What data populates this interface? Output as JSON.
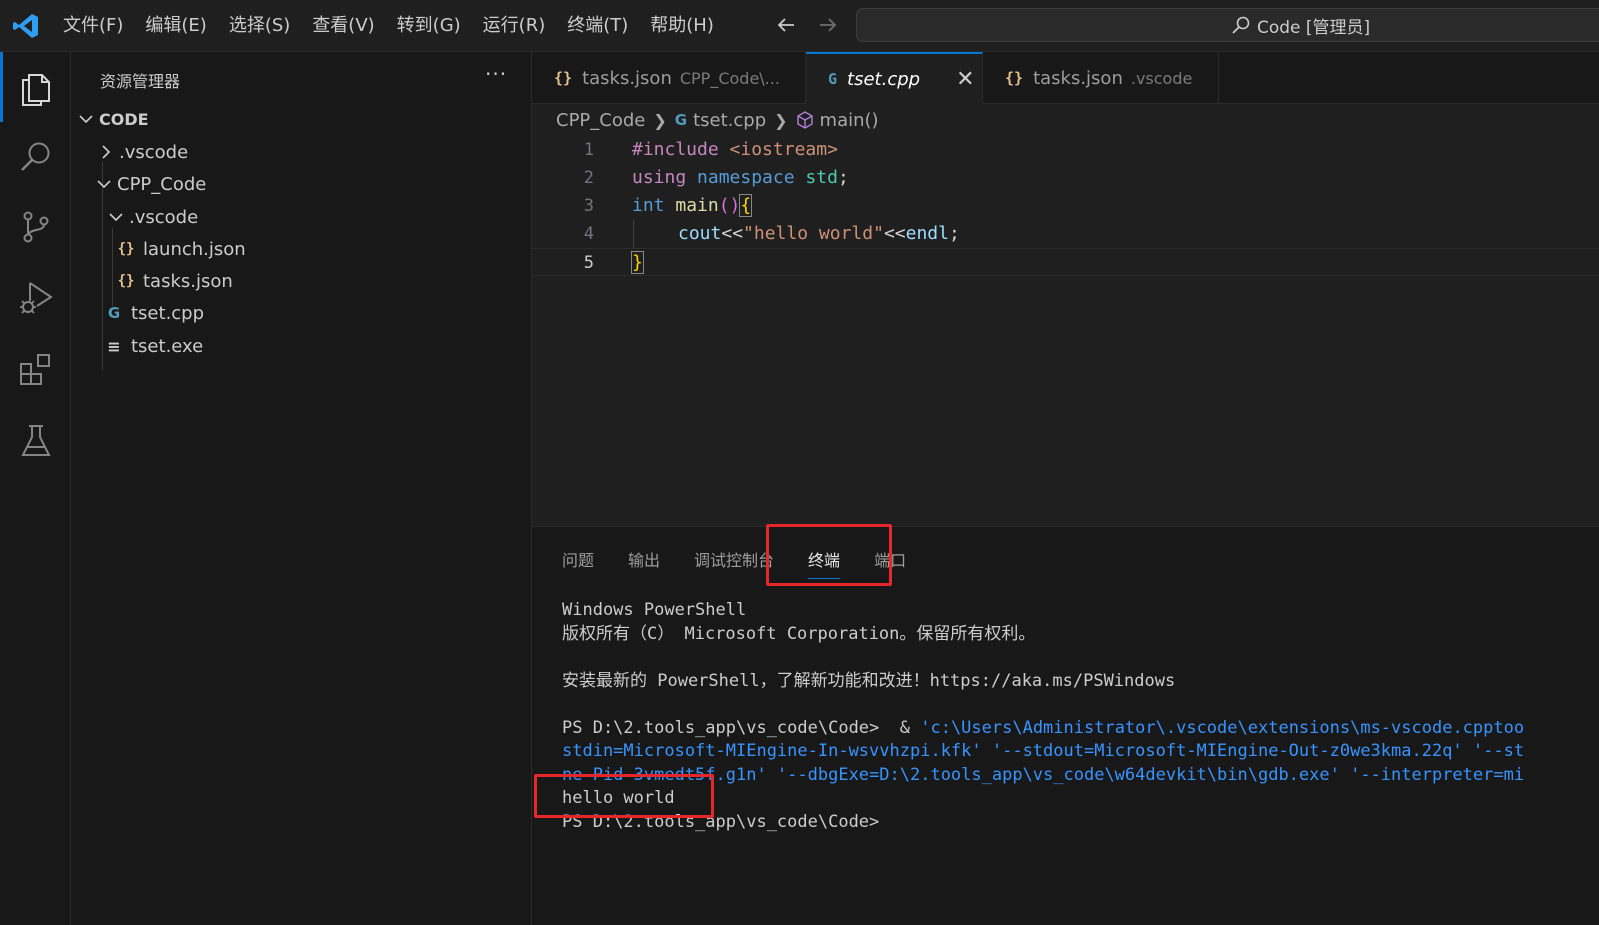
{
  "menu": [
    "文件(F)",
    "编辑(E)",
    "选择(S)",
    "查看(V)",
    "转到(G)",
    "运行(R)",
    "终端(T)",
    "帮助(H)"
  ],
  "command_center": {
    "text": "Code [管理员]"
  },
  "explorer": {
    "title": "资源管理器",
    "more": "···",
    "root": "CODE",
    "items": [
      ".vscode",
      "CPP_Code",
      ".vscode",
      "launch.json",
      "tasks.json",
      "tset.cpp",
      "tset.exe"
    ]
  },
  "tabs": [
    {
      "icon": "{}",
      "name": "tasks.json",
      "desc": "CPP_Code\\..."
    },
    {
      "icon": "G",
      "name": "tset.cpp",
      "desc": "",
      "close": "✕"
    },
    {
      "icon": "{}",
      "name": "tasks.json",
      "desc": ".vscode"
    }
  ],
  "breadcrumb": [
    "CPP_Code",
    "tset.cpp",
    "main()"
  ],
  "code": {
    "line_numbers": [
      "1",
      "2",
      "3",
      "4",
      "5"
    ],
    "l1": {
      "pre": "#include",
      "inc": "<iostream>"
    },
    "l2": {
      "using": "using",
      "namespace": "namespace",
      "std": "std",
      "semi": ";"
    },
    "l3": {
      "int": "int",
      "main": "main",
      "paren": "()",
      "brace": "{"
    },
    "l4": {
      "cout": "cout",
      "op1": "<<",
      "str": "\"hello world\"",
      "op2": "<<",
      "endl": "endl",
      "semi": ";"
    },
    "l5": {
      "brace": "}"
    }
  },
  "panel": {
    "tabs": [
      "问题",
      "输出",
      "调试控制台",
      "终端",
      "端口"
    ],
    "active_tab": "终端"
  },
  "terminal": {
    "l1": "Windows PowerShell",
    "l2": "版权所有（C） Microsoft Corporation。保留所有权利。",
    "l3": "安装最新的 PowerShell，了解新功能和改进！https://aka.ms/PSWindows",
    "l4_prompt": "PS D:\\2.tools_app\\vs_code\\Code>  & ",
    "l4_str": "'c:\\Users\\Administrator\\.vscode\\extensions\\ms-vscode.cpptoo",
    "l5": "stdin=Microsoft-MIEngine-In-wsvvhzpi.kfk' '--stdout=Microsoft-MIEngine-Out-z0we3kma.22q' '--st",
    "l6": "ne-Pid-3vmedt5f.g1n' '--dbgExe=D:\\2.tools_app\\vs_code\\w64devkit\\bin\\gdb.exe' '--interpreter=mi",
    "l7": "hello world",
    "l8": "PS D:\\2.tools_app\\vs_code\\Code>"
  }
}
